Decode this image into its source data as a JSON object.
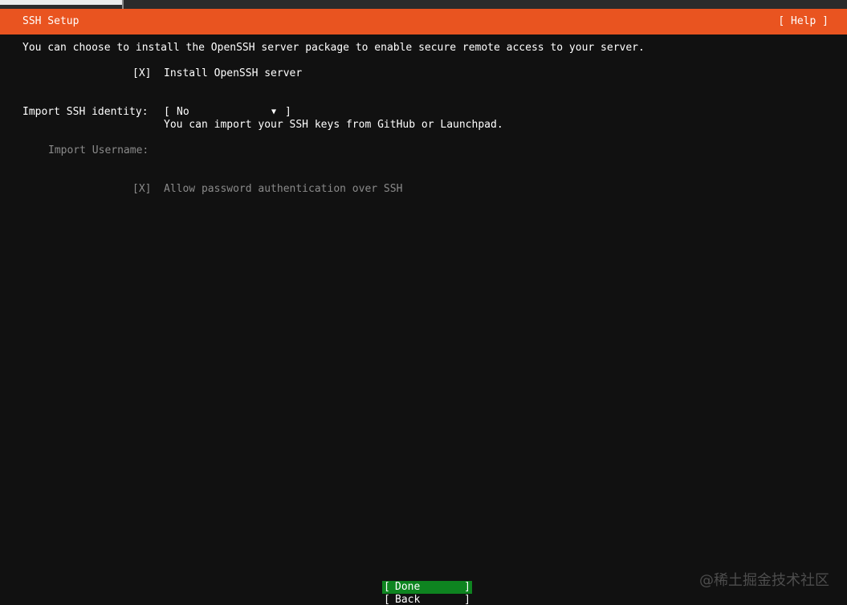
{
  "header": {
    "title": "SSH Setup",
    "help_label": "[ Help ]"
  },
  "intro_text": "You can choose to install the OpenSSH server package to enable secure remote access to your server.",
  "install_openssh": {
    "checkbox": "[X]",
    "label": "Install OpenSSH server"
  },
  "import_identity": {
    "label": "Import SSH identity:",
    "bracket_open": "[",
    "value": "No",
    "arrow": "▼",
    "bracket_close": "]",
    "hint": "You can import your SSH keys from GitHub or Launchpad."
  },
  "import_username": {
    "label": "Import Username:"
  },
  "allow_password": {
    "checkbox": "[X]",
    "label": "Allow password authentication over SSH"
  },
  "buttons": {
    "bracket_open": "[",
    "bracket_close": "]",
    "done": "Done",
    "back": "Back"
  },
  "watermark": "@稀土掘金技术社区",
  "colors": {
    "header_bg": "#e95420",
    "done_bg": "#0e8420",
    "background": "#111111",
    "disabled_text": "#8a8a8a"
  }
}
